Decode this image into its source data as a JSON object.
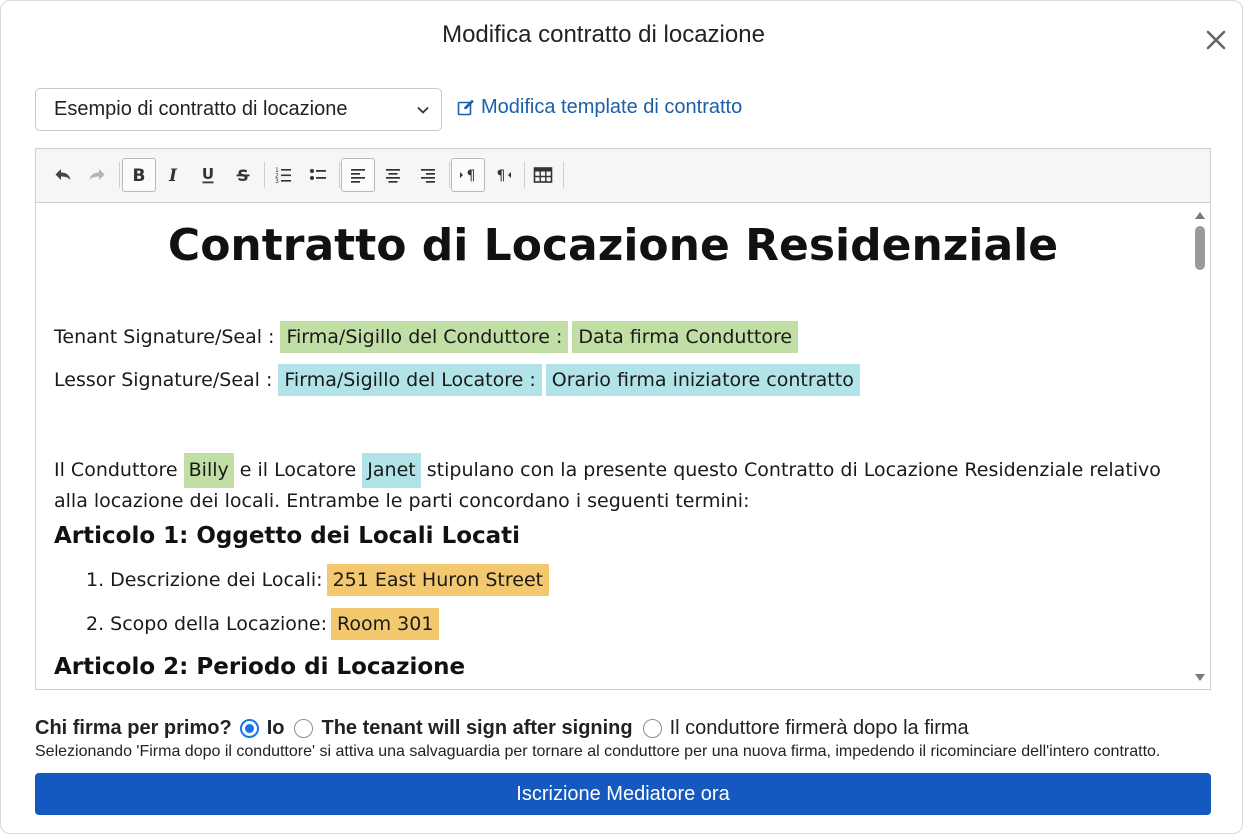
{
  "modal": {
    "title": "Modifica contratto di locazione"
  },
  "template_select": {
    "value": "Esempio di contratto di locazione"
  },
  "edit_template_link": {
    "label": "Modifica template di contratto"
  },
  "toolbar": {
    "buttons": [
      "undo-icon",
      "redo-icon",
      "bold-icon",
      "italic-icon",
      "underline-icon",
      "strikethrough-icon",
      "ordered-list-icon",
      "unordered-list-icon",
      "align-left-icon",
      "align-center-icon",
      "align-right-icon",
      "ltr-icon",
      "rtl-icon",
      "table-icon"
    ]
  },
  "document": {
    "title": "Contratto di Locazione Residenziale",
    "tenant_label": "Tenant Signature/Seal :",
    "tenant_sig_field": "Firma/Sigillo del Conduttore :",
    "tenant_date_field": "Data firma Conduttore",
    "lessor_label": "Lessor Signature/Seal :",
    "lessor_sig_field": "Firma/Sigillo del Locatore :",
    "lessor_time_field": "Orario firma iniziatore contratto",
    "intro_part1": "Il Conduttore",
    "tenant_name": "Billy",
    "intro_part2": "e il Locatore",
    "lessor_name": "Janet",
    "intro_part3": "stipulano con la presente questo Contratto di Locazione Residenziale relativo alla locazione dei locali. Entrambe le parti concordano i seguenti termini:",
    "article1": "Articolo 1: Oggetto dei Locali Locati",
    "item1_label": "1. Descrizione dei Locali:",
    "item1_value": "251 East Huron Street",
    "item2_label": "2. Scopo della Locazione:",
    "item2_value": "Room 301",
    "article2": "Articolo 2: Periodo di Locazione"
  },
  "signing_order": {
    "question": "Chi firma per primo?",
    "options": [
      {
        "label": "Io",
        "selected": true
      },
      {
        "label": "The tenant will sign after signing",
        "selected": false
      },
      {
        "label": "Il conduttore firmerà dopo la firma",
        "selected": false
      }
    ],
    "note": "Selezionando 'Firma dopo il conduttore' si attiva una salvaguardia per tornare al conduttore per una nuova firma, impedendo il ricominciare dell'intero contratto."
  },
  "submit_button": {
    "label": "Iscrizione Mediatore ora"
  },
  "colors": {
    "accent": "#1559c0",
    "link": "#1c5fa8",
    "tenant_highlight": "#c1dea4",
    "lessor_highlight": "#b1e3e8",
    "field_highlight": "#f4c86e"
  }
}
